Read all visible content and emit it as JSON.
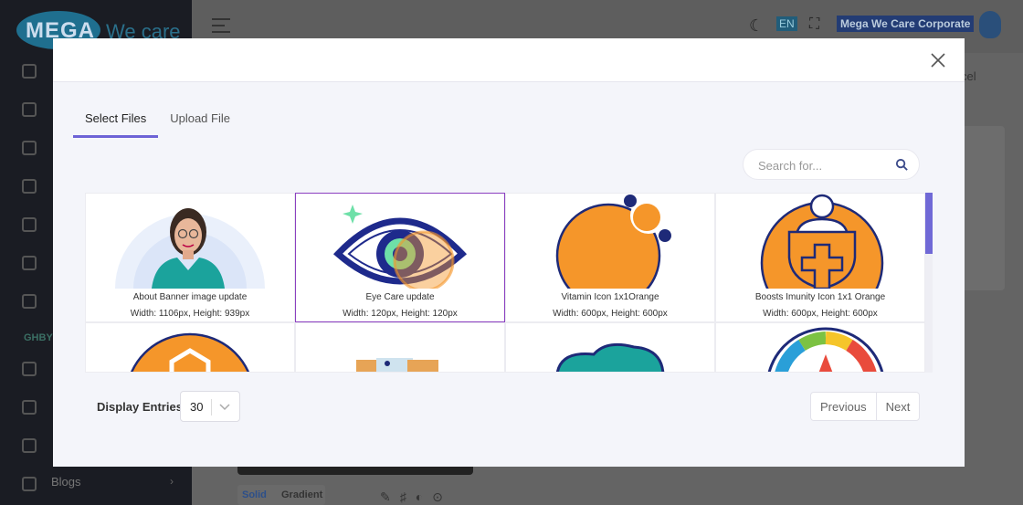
{
  "background": {
    "brand_left": "MEGA",
    "brand_right": "We care",
    "lang": "EN",
    "company": "Mega We Care Corporate",
    "sidebar_group": "GHBY",
    "sidebar_blogs": "Blogs",
    "cancel_partial": "cel",
    "color_tab_solid": "Solid",
    "color_tab_gradient": "Gradient"
  },
  "modal": {
    "tabs": [
      {
        "label": "Select Files",
        "active": true
      },
      {
        "label": "Upload File",
        "active": false
      }
    ],
    "search": {
      "placeholder": "Search for..."
    },
    "files": [
      {
        "name": "About Banner image update",
        "dims": "Width: 1106px, Height: 939px",
        "selected": false
      },
      {
        "name": "Eye Care update",
        "dims": "Width: 120px, Height: 120px",
        "selected": true
      },
      {
        "name": "Vitamin Icon 1x1Orange",
        "dims": "Width: 600px, Height: 600px",
        "selected": false
      },
      {
        "name": "Boosts Imunity Icon 1x1 Orange",
        "dims": "Width: 600px, Height: 600px",
        "selected": false
      }
    ],
    "entries": {
      "label": "Display Entries:",
      "value": "30"
    },
    "pager": {
      "prev": "Previous",
      "next": "Next"
    },
    "colors": {
      "accent": "#6d63d6",
      "selected_border": "#8b3fc0",
      "orange": "#f5962a",
      "navy": "#1e2a78"
    }
  }
}
